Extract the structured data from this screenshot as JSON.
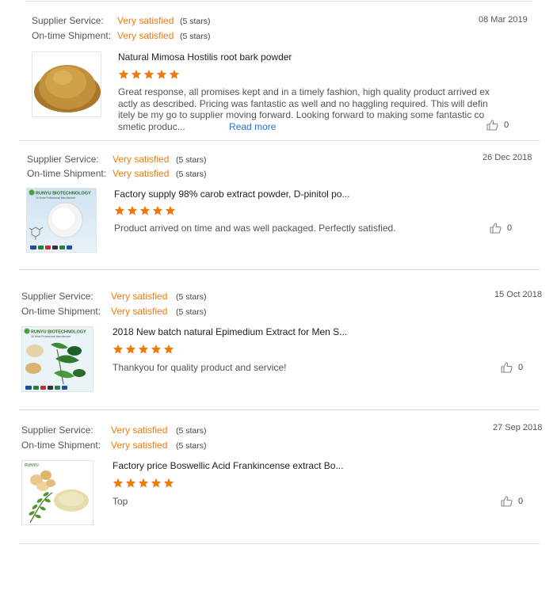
{
  "labels": {
    "supplier_service": "Supplier Service:",
    "ontime_shipment": "On-time Shipment:",
    "read_more": "Read more"
  },
  "reviews": [
    {
      "supplier_service": "Very satisfied",
      "supplier_stars": "(5 stars)",
      "shipment": "Very satisfied",
      "shipment_stars": "(5 stars)",
      "date": "08 Mar 2019",
      "product": "Natural Mimosa Hostilis root bark powder",
      "rating": 5,
      "text_lines": [
        "Great response, all promises kept and in a timely fashion, high quality product arrived ex",
        "actly as described. Pricing was fantastic as well and no haggling required. This will defin",
        "itely be my go to supplier moving forward. Looking forward to making some fantastic co",
        "smetic produc..."
      ],
      "likes": "0",
      "thumb_icon": "brown-powder-image"
    },
    {
      "supplier_service": "Very satisfied",
      "supplier_stars": "(5 stars)",
      "shipment": "Very satisfied",
      "shipment_stars": "(5 stars)",
      "date": "26 Dec 2018",
      "product": "Factory supply 98% carob extract powder, D-pinitol po...",
      "rating": 5,
      "text": "Product arrived on time and was well packaged. Perfectly satisfied.",
      "likes": "0",
      "thumb_icon": "white-powder-image",
      "thumb_brand": "RUNYU BIOTECHNOLOGY",
      "thumb_slogan": "16 Years Professional Manufacturer"
    },
    {
      "supplier_service": "Very satisfied",
      "supplier_stars": "(5 stars)",
      "shipment": "Very satisfied",
      "shipment_stars": "(5 stars)",
      "date": "15 Oct 2018",
      "product": "2018 New batch natural Epimedium Extract for Men S...",
      "rating": 5,
      "text": "Thankyou for quality product and service!",
      "likes": "0",
      "thumb_icon": "epimedium-extract-image",
      "thumb_brand": "RUNYU BIOTECHNOLOGY",
      "thumb_slogan": "16 Years Professional Manufacturer"
    },
    {
      "supplier_service": "Very satisfied",
      "supplier_stars": "(5 stars)",
      "shipment": "Very satisfied",
      "shipment_stars": "(5 stars)",
      "date": "27 Sep 2018",
      "product": "Factory price Boswellic Acid Frankincense extract Bo...",
      "rating": 5,
      "text": "Top",
      "likes": "0",
      "thumb_icon": "frankincense-image",
      "thumb_brand": "RUNYU"
    }
  ],
  "colors": {
    "accent": "#f07a12",
    "link": "#2a6fd6",
    "divider": "#dcdcdc"
  }
}
